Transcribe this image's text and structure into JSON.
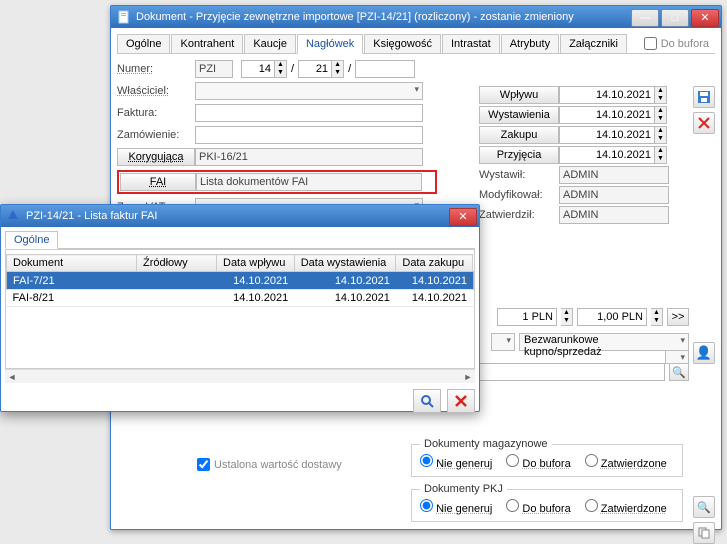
{
  "main": {
    "title": "Dokument - Przyjęcie zewnętrzne importowe [PZI-14/21] (rozliczony) - zostanie zmieniony",
    "tabs": [
      "Ogólne",
      "Kontrahent",
      "Kaucje",
      "Nagłówek",
      "Księgowość",
      "Intrastat",
      "Atrybuty",
      "Załączniki"
    ],
    "active_tab": "Nagłówek",
    "do_bufora": "Do bufora",
    "left": {
      "numer_lbl": "Numer:",
      "numer_series": "PZI",
      "numer_n1": "14",
      "numer_n2": "21",
      "wlasciciel_lbl": "Właściciel:",
      "wlasciciel_val": "",
      "faktura_lbl": "Faktura:",
      "zamowienie_lbl": "Zamówienie:",
      "koryg_btn": "Korygująca",
      "koryg_val": "PKI-16/21",
      "fai_btn": "FAI",
      "fai_val": "Lista dokumentów FAI",
      "zwvat_lbl": "Zw. z VAT:"
    },
    "right": {
      "wplywu_btn": "Wpływu",
      "wplywu_val": "14.10.2021",
      "wyst_btn": "Wystawienia",
      "wyst_val": "14.10.2021",
      "zakupu_btn": "Zakupu",
      "zakupu_val": "14.10.2021",
      "przyj_btn": "Przyjęcia",
      "przyj_val": "14.10.2021",
      "wystawil_lbl": "Wystawił:",
      "wystawil_val": "ADMIN",
      "modyf_lbl": "Modyfikował:",
      "modyf_val": "ADMIN",
      "zatw_lbl": "Zatwierdził:",
      "zatw_val": "ADMIN"
    },
    "mid": {
      "pln_qty": "1 PLN",
      "pln_price": "1,00 PLN",
      "bezwar": "Bezwarunkowe kupno/sprzedaż"
    },
    "ustalona": "Ustalona wartość dostawy",
    "fs1": {
      "legend": "Dokumenty magazynowe",
      "opts": [
        "Nie generuj",
        "Do bufora",
        "Zatwierdzone"
      ]
    },
    "fs2": {
      "legend": "Dokumenty PKJ",
      "opts": [
        "Nie generuj",
        "Do bufora",
        "Zatwierdzone"
      ]
    }
  },
  "child": {
    "title": "PZI-14/21 - Lista faktur FAI",
    "tab": "Ogólne",
    "cols": [
      "Dokument",
      "Źródłowy",
      "Data wpływu",
      "Data wystawienia",
      "Data zakupu"
    ],
    "rows": [
      {
        "dok": "FAI-7/21",
        "src": "",
        "wp": "14.10.2021",
        "ws": "14.10.2021",
        "zk": "14.10.2021",
        "sel": true
      },
      {
        "dok": "FAI-8/21",
        "src": "",
        "wp": "14.10.2021",
        "ws": "14.10.2021",
        "zk": "14.10.2021",
        "sel": false
      }
    ]
  },
  "icons": {
    "doc": "doc-icon",
    "save": "💾",
    "close": "✕",
    "min": "—",
    "max": "□",
    "magnify": "🔍",
    "x": "✕",
    "up": "▲",
    "dn": "▼",
    "user": "👤",
    "search2": "🔍"
  }
}
